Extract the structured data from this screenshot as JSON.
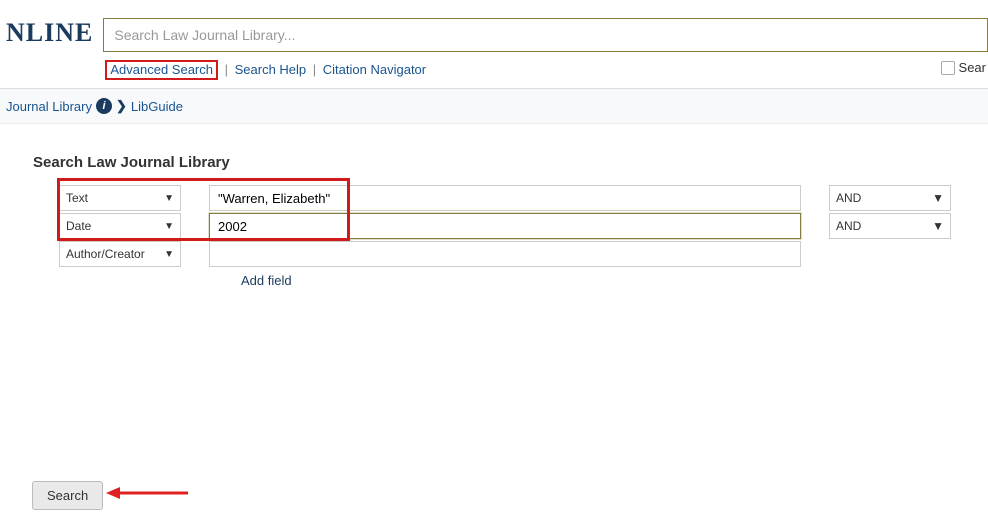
{
  "header": {
    "logo_fragment": "NLINE",
    "search_placeholder": "Search Law Journal Library...",
    "links": {
      "advanced_search": "Advanced Search",
      "search_help": "Search Help",
      "citation_navigator": "Citation Navigator"
    },
    "searx_label": "Sear"
  },
  "breadcrumb": {
    "journal_library": "Journal Library",
    "libguide": "LibGuide"
  },
  "panel": {
    "title": "Search Law Journal Library",
    "rows": [
      {
        "field": "Text",
        "value": "\"Warren, Elizabeth\"",
        "op": "AND"
      },
      {
        "field": "Date",
        "value": "2002",
        "op": "AND"
      },
      {
        "field": "Author/Creator",
        "value": "",
        "op": ""
      }
    ],
    "add_field_label": "Add field",
    "search_button": "Search"
  }
}
